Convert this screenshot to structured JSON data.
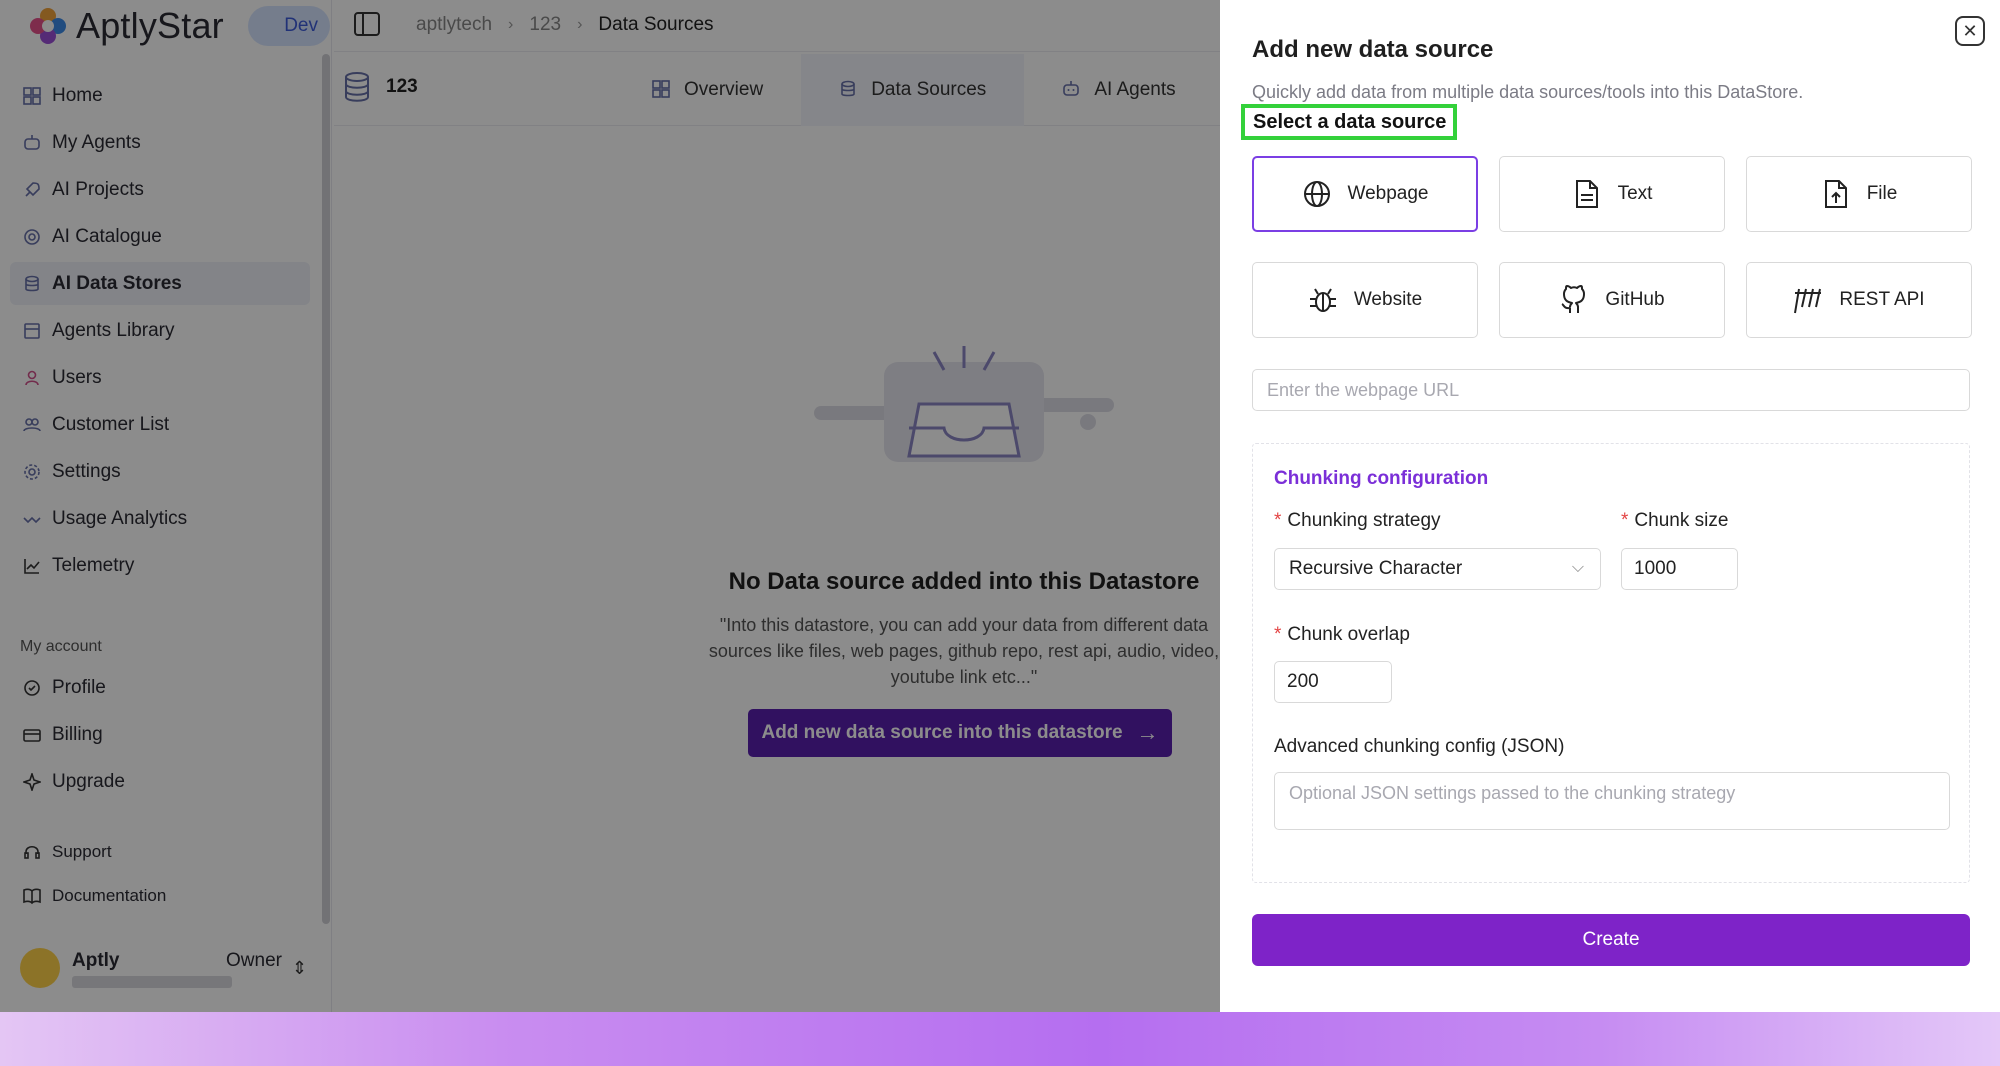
{
  "app": {
    "brand": "AptlyStar",
    "env_badge": "Dev"
  },
  "sidebar": {
    "items": [
      {
        "label": "Home",
        "icon": "home-icon"
      },
      {
        "label": "My Agents",
        "icon": "agents-icon"
      },
      {
        "label": "AI Projects",
        "icon": "rocket-icon"
      },
      {
        "label": "AI Catalogue",
        "icon": "catalogue-icon"
      },
      {
        "label": "AI Data Stores",
        "icon": "database-icon",
        "active": true
      },
      {
        "label": "Agents Library",
        "icon": "library-icon"
      },
      {
        "label": "Users",
        "icon": "user-icon"
      },
      {
        "label": "Customer List",
        "icon": "customers-icon"
      },
      {
        "label": "Settings",
        "icon": "gear-icon"
      },
      {
        "label": "Usage Analytics",
        "icon": "analytics-icon"
      },
      {
        "label": "Telemetry",
        "icon": "chart-icon"
      }
    ],
    "account_label": "My account",
    "account_items": [
      {
        "label": "Profile",
        "icon": "profile-icon"
      },
      {
        "label": "Billing",
        "icon": "billing-icon"
      },
      {
        "label": "Upgrade",
        "icon": "sparkle-icon"
      }
    ],
    "help_items": [
      {
        "label": "Support",
        "icon": "headset-icon"
      },
      {
        "label": "Documentation",
        "icon": "book-icon"
      }
    ],
    "user": {
      "name": "Aptly",
      "role": "Owner"
    }
  },
  "breadcrumb": [
    "aptlytech",
    "123",
    "Data Sources"
  ],
  "datastore": {
    "name": "123"
  },
  "tabs": [
    {
      "label": "Overview",
      "icon": "grid-icon"
    },
    {
      "label": "Data Sources",
      "icon": "database-icon",
      "active": true
    },
    {
      "label": "AI Agents",
      "icon": "robot-icon"
    }
  ],
  "empty_state": {
    "title": "No Data source added into this Datastore",
    "description": "\"Into this datastore, you can add your data from different data sources like files, web pages, github repo, rest api, audio, video, youtube link etc...\"",
    "cta": "Add new data source into this datastore"
  },
  "drawer": {
    "title": "Add new data source",
    "description": "Quickly add data from multiple data sources/tools into this DataStore.",
    "select_label": "Select a data source",
    "sources": [
      {
        "label": "Webpage",
        "icon": "globe-icon",
        "selected": true
      },
      {
        "label": "Text",
        "icon": "document-icon"
      },
      {
        "label": "File",
        "icon": "file-upload-icon"
      },
      {
        "label": "Website",
        "icon": "bug-icon"
      },
      {
        "label": "GitHub",
        "icon": "github-icon"
      },
      {
        "label": "REST API",
        "icon": "api-icon"
      }
    ],
    "url_placeholder": "Enter the webpage URL",
    "url_value": "",
    "chunking": {
      "title": "Chunking configuration",
      "strategy_label": "Chunking strategy",
      "strategy_value": "Recursive Character",
      "size_label": "Chunk size",
      "size_value": "1000",
      "overlap_label": "Chunk overlap",
      "overlap_value": "200",
      "advanced_label": "Advanced chunking config (JSON)",
      "advanced_placeholder": "Optional JSON settings passed to the chunking strategy"
    },
    "create_label": "Create"
  },
  "colors": {
    "accent": "#7e23c8",
    "highlight": "#33d13a",
    "selected_border": "#7b3fe4",
    "required": "#e34444"
  }
}
